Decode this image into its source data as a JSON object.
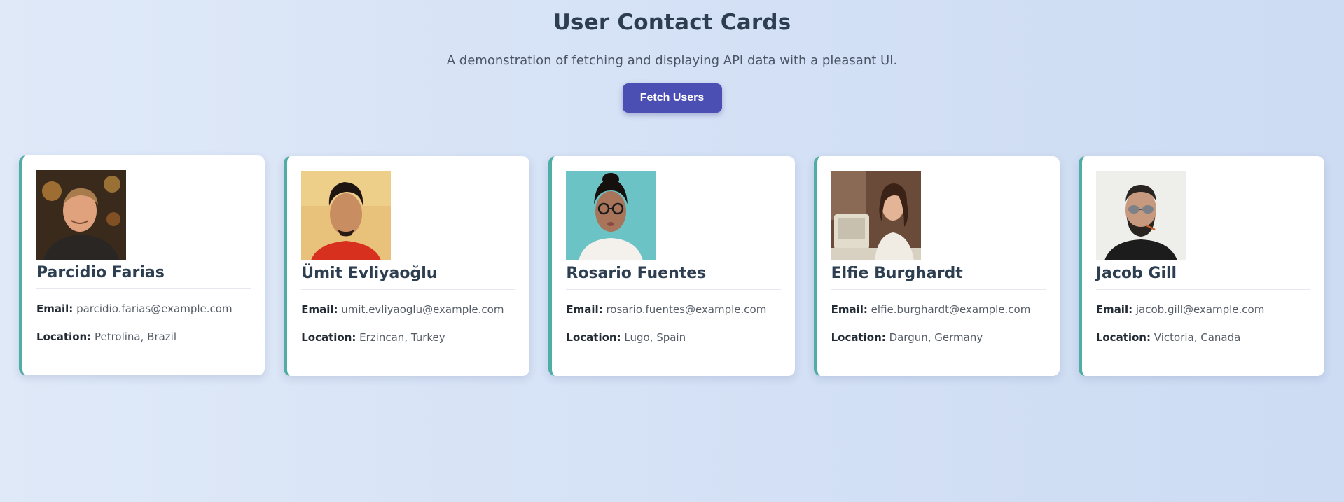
{
  "header": {
    "title": "User Contact Cards",
    "subtitle": "A demonstration of fetching and displaying API data with a pleasant UI.",
    "fetch_button_label": "Fetch Users"
  },
  "labels": {
    "email": "Email:",
    "location": "Location:"
  },
  "colors": {
    "accent_border": "#4fada5",
    "button": "#4b4fb3",
    "title": "#2c3e50"
  },
  "users": [
    {
      "name": "Parcidio Farias",
      "email": "parcidio.farias@example.com",
      "location": "Petrolina, Brazil",
      "photo": "portrait-photo"
    },
    {
      "name": "Ümit Evliyaoğlu",
      "email": "umit.evliyaoglu@example.com",
      "location": "Erzincan, Turkey",
      "photo": "portrait-photo"
    },
    {
      "name": "Rosario Fuentes",
      "email": "rosario.fuentes@example.com",
      "location": "Lugo, Spain",
      "photo": "portrait-photo"
    },
    {
      "name": "Elfie Burghardt",
      "email": "elfie.burghardt@example.com",
      "location": "Dargun, Germany",
      "photo": "portrait-photo"
    },
    {
      "name": "Jacob Gill",
      "email": "jacob.gill@example.com",
      "location": "Victoria, Canada",
      "photo": "portrait-photo"
    }
  ]
}
